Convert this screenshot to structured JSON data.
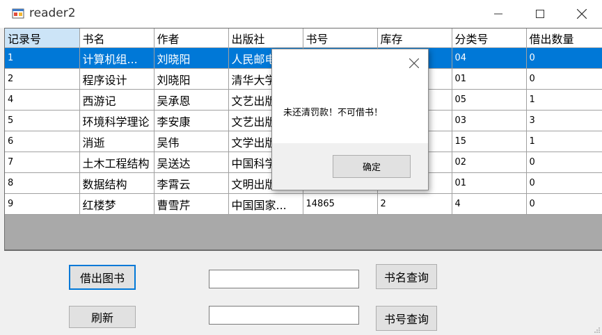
{
  "window": {
    "title": "reader2"
  },
  "grid": {
    "columns": [
      "记录号",
      "书名",
      "作者",
      "出版社",
      "书号",
      "库存",
      "分类号",
      "借出数量"
    ],
    "rows": [
      [
        "1",
        "计算机组...",
        "刘晓阳",
        "人民邮电",
        "",
        "",
        "04",
        "0"
      ],
      [
        "2",
        "程序设计",
        "刘晓阳",
        "清华大学",
        "",
        "",
        "01",
        "0"
      ],
      [
        "4",
        "西游记",
        "吴承恩",
        "文艺出版",
        "",
        "",
        "05",
        "1"
      ],
      [
        "5",
        "环境科学理论",
        "李安康",
        "文艺出版",
        "",
        "",
        "03",
        "3"
      ],
      [
        "6",
        "消逝",
        "吴伟",
        "文学出版",
        "",
        "",
        "15",
        "1"
      ],
      [
        "7",
        "土木工程结构",
        "吴送达",
        "中国科学",
        "",
        "",
        "02",
        "0"
      ],
      [
        "8",
        "数据结构",
        "李霄云",
        "文明出版",
        "",
        "",
        "01",
        "0"
      ],
      [
        "9",
        "红楼梦",
        "曹雪芹",
        "中国国家...",
        "14865",
        "2",
        "4",
        "0"
      ]
    ],
    "selected_row": 0
  },
  "buttons": {
    "borrow": "借出图书",
    "refresh": "刷新",
    "search_name": "书名查询",
    "search_number": "书号查询"
  },
  "inputs": {
    "name_query": "",
    "number_query": ""
  },
  "dialog": {
    "message": "未还清罚款！不可借书！",
    "ok": "确定"
  },
  "colors": {
    "selection": "#0078d7",
    "header_selected": "#cce4f7",
    "grid_empty": "#a9a9a9"
  }
}
